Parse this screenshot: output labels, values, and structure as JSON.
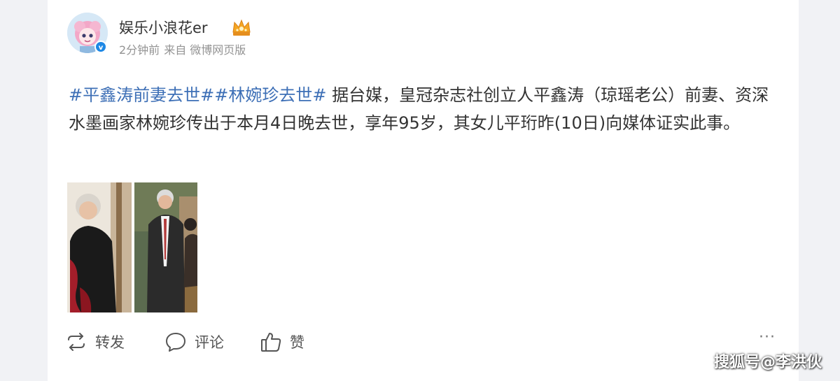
{
  "post": {
    "author": {
      "name": "娱乐小浪花er",
      "avatar_icon": "anime-avatar",
      "verified_icon": "verified-badge-icon",
      "crown_icon": "crown-icon"
    },
    "time": "2分钟前",
    "source": "来自 微博网页版",
    "topics": [
      "#平鑫涛前妻去世#",
      "#林婉珍去世#"
    ],
    "body_text": " 据台媒，皇冠杂志社创立人平鑫涛（琼瑶老公）前妻、资深水墨画家林婉珍传出于本月4日晚去世，享年95岁，其女儿平珩昨(10日)向媒体证实此事。",
    "image_description": "photo-collage"
  },
  "actions": {
    "repost_label": "转发",
    "comment_label": "评论",
    "like_label": "赞",
    "more_label": "···"
  },
  "watermark": "搜狐号@李洪伙",
  "colors": {
    "topic": "#3d6fb6",
    "background": "#f1f2f5",
    "card": "#ffffff",
    "text": "#333333",
    "meta": "#939393"
  }
}
